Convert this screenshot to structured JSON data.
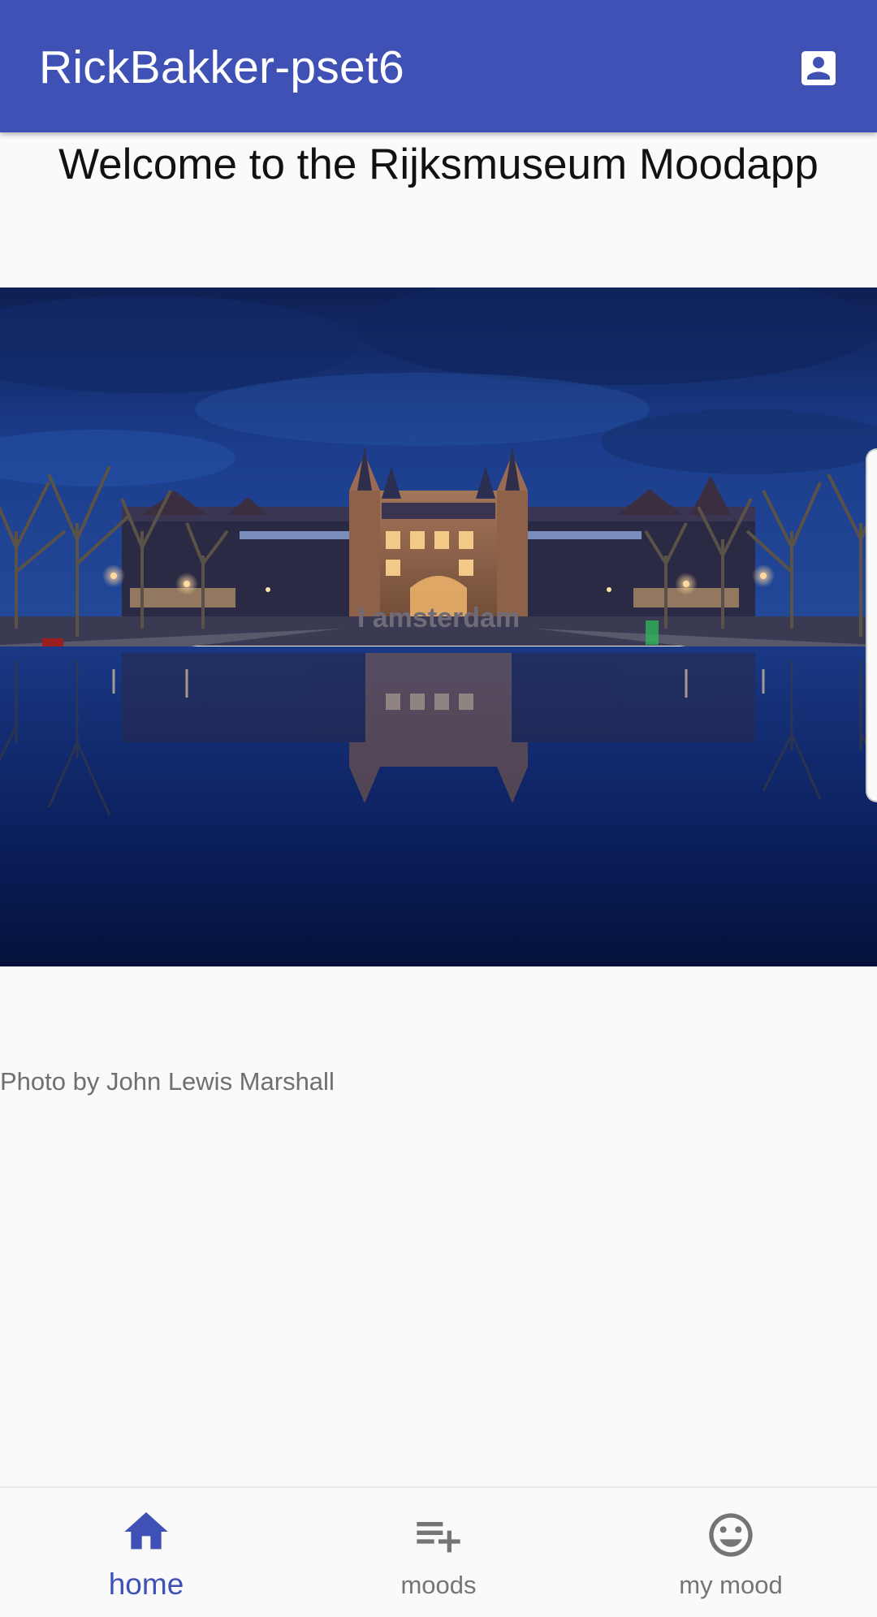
{
  "app_bar": {
    "title": "RickBakker-pset6",
    "account_icon": "account-box-icon"
  },
  "main": {
    "welcome": "Welcome to the Rijksmuseum Moodapp",
    "photo_credit": "Photo by John Lewis Marshall",
    "hero_sign_text": "I amsterdam"
  },
  "bottom_nav": {
    "items": [
      {
        "label": "home",
        "icon": "home-icon",
        "active": true
      },
      {
        "label": "moods",
        "icon": "playlist-add-icon",
        "active": false
      },
      {
        "label": "my mood",
        "icon": "smiley-face-icon",
        "active": false
      }
    ]
  },
  "colors": {
    "primary": "#3f51b5",
    "inactive": "#757575",
    "background": "#fafafa"
  }
}
